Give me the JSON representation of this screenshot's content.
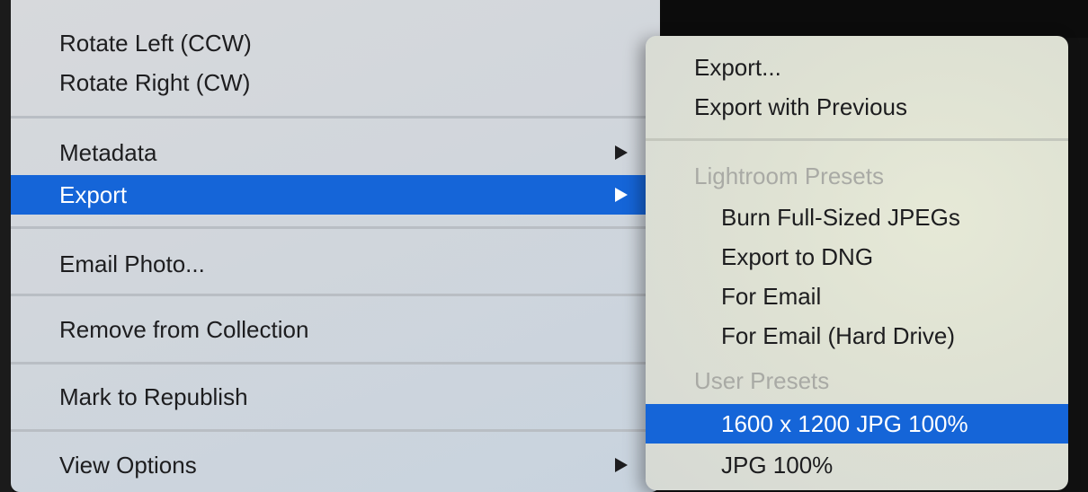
{
  "main_menu": {
    "rotate_left": "Rotate Left (CCW)",
    "rotate_right": "Rotate Right (CW)",
    "metadata": "Metadata",
    "export": "Export",
    "email_photo": "Email Photo...",
    "remove_from_collection": "Remove from Collection",
    "mark_to_republish": "Mark to Republish",
    "view_options": "View Options"
  },
  "export_submenu": {
    "export": "Export...",
    "export_with_previous": "Export with Previous",
    "lightroom_presets_header": "Lightroom Presets",
    "lightroom_presets": [
      "Burn Full-Sized JPEGs",
      "Export to DNG",
      "For Email",
      "For Email (Hard Drive)"
    ],
    "user_presets_header": "User Presets",
    "user_presets": [
      "1600 x 1200 JPG 100%",
      "JPG 100%"
    ]
  },
  "colors": {
    "selection": "#1565d8",
    "header_text": "#a9aaa5"
  }
}
